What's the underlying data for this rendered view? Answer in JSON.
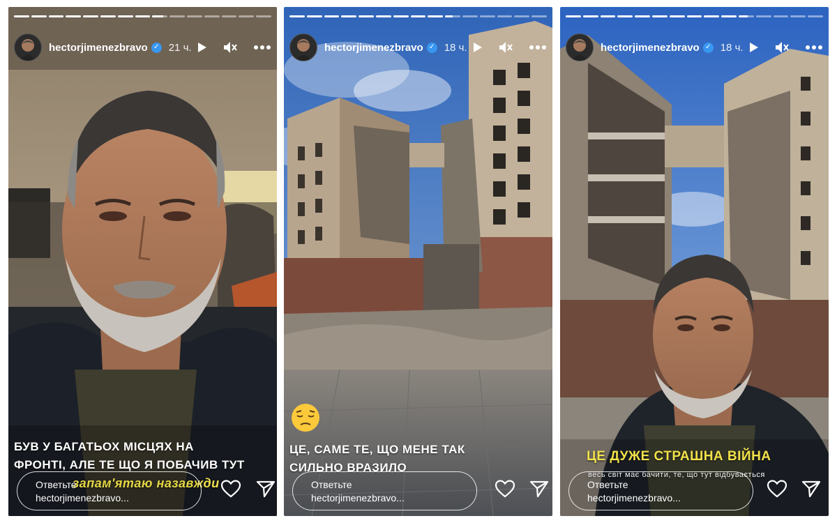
{
  "stories": [
    {
      "username": "hectorjimenezbravo",
      "time": "21 ч.",
      "progress": [
        1,
        1,
        1,
        1,
        1,
        1,
        1,
        1,
        0.7,
        0,
        0,
        0,
        0,
        0,
        0
      ],
      "caption_lines": [
        "БУВ У БАГАТЬОХ МІСЦЯХ НА",
        "ФРОНТІ, АЛЕ ТЕ ЩО Я ПОБАЧИВ ТУТ"
      ],
      "caption_highlight": "запам'ятаю назавжди",
      "reply_line1": "Ответьте",
      "reply_line2": "hectorjimenezbravo..."
    },
    {
      "username": "hectorjimenezbravo",
      "time": "18 ч.",
      "progress": [
        1,
        1,
        1,
        1,
        1,
        1,
        1,
        1,
        1,
        0.5,
        0,
        0,
        0,
        0,
        0
      ],
      "caption_lines": [
        "ЦЕ, САМЕ ТЕ, ЩО МЕНЕ ТАК",
        "СИЛЬНО ВРАЗИЛО"
      ],
      "emoji": "pensive-face",
      "reply_line1": "Ответьте",
      "reply_line2": "hectorjimenezbravo..."
    },
    {
      "username": "hectorjimenezbravo",
      "time": "18 ч.",
      "progress": [
        1,
        1,
        1,
        1,
        1,
        1,
        1,
        1,
        1,
        1,
        0.6,
        0,
        0,
        0,
        0
      ],
      "caption_highlight": "ЦЕ ДУЖЕ СТРАШНА ВІЙНА",
      "caption_small": "весь світ має бачити, те, що тут відбувається",
      "reply_line1": "Ответьте",
      "reply_line2": "hectorjimenezbravo..."
    }
  ],
  "colors": {
    "verified": "#3897f0",
    "highlight": "#f1e14a",
    "sky": "#3f78c9"
  },
  "icons": [
    "play-icon",
    "mute-icon",
    "more-icon",
    "heart-icon",
    "send-icon",
    "verified-icon"
  ]
}
